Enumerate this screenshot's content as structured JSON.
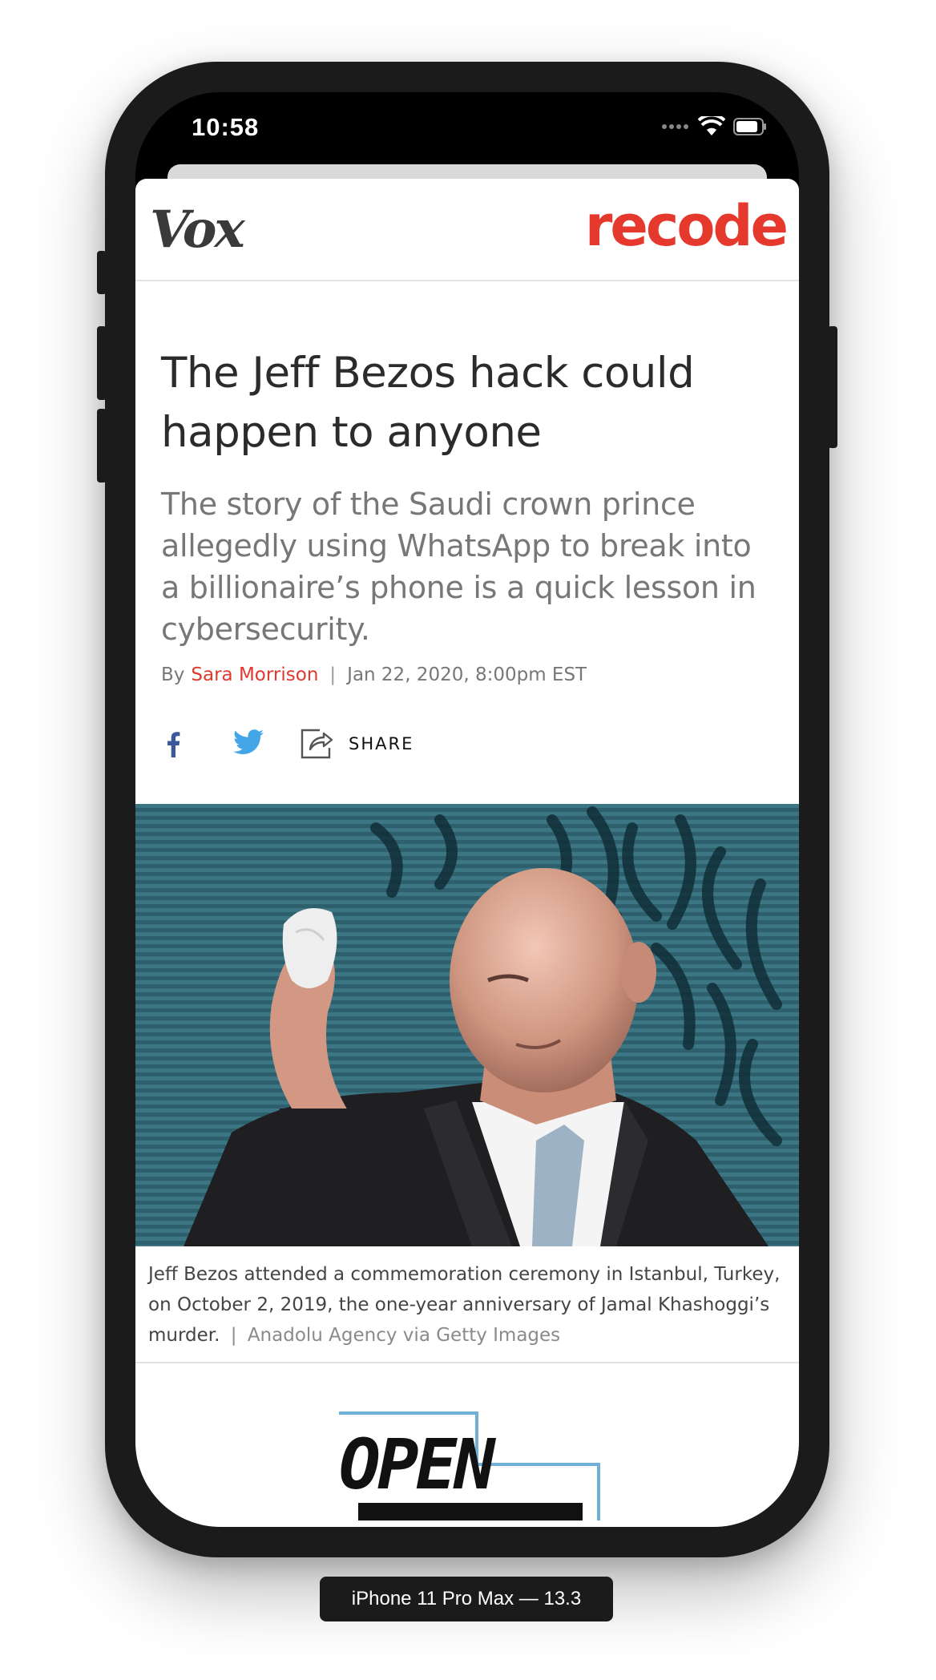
{
  "status_bar": {
    "time": "10:58"
  },
  "header": {
    "vox_logo": "Vox",
    "recode_logo": "recode"
  },
  "article": {
    "headline": "The Jeff Bezos hack could happen to anyone",
    "dek": "The story of the Saudi crown prince allegedly using WhatsApp to break into a billionaire’s phone is a quick lesson in cybersecurity.",
    "byline_prefix": "By",
    "author": "Sara Morrison",
    "byline_separator": "|",
    "date": "Jan 22, 2020, 8:00pm EST",
    "share_label": "SHARE"
  },
  "photo": {
    "caption": "Jeff Bezos attended a commemoration ceremony in Istanbul, Turkey, on October 2, 2019, the one-year anniversary of Jamal Khashoggi’s murder.",
    "caption_separator": "|",
    "credit": "Anadolu Agency via Getty Images"
  },
  "promo": {
    "logo_text": "OPEN"
  },
  "device": {
    "label": "iPhone 11 Pro Max — 13.3"
  },
  "colors": {
    "accent_red": "#e5392e",
    "facebook": "#3b5998",
    "twitter": "#1da1f2"
  }
}
